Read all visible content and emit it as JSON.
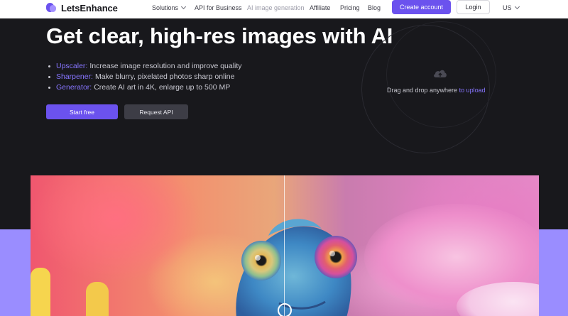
{
  "nav": {
    "brand": "LetsEnhance",
    "links": [
      {
        "label": "Solutions"
      },
      {
        "label": "API for Business"
      },
      {
        "label": "AI image generation"
      },
      {
        "label": "Affiliate"
      },
      {
        "label": "Pricing"
      },
      {
        "label": "Blog"
      }
    ],
    "create_account": "Create account",
    "login": "Login",
    "language": "US"
  },
  "hero": {
    "title": "Get clear, high-res images with AI",
    "features": [
      {
        "key": "Upscaler:",
        "text": "Increase image resolution and improve quality"
      },
      {
        "key": "Sharpener:",
        "text": "Make blurry, pixelated photos sharp online"
      },
      {
        "key": "Generator:",
        "text": "Create AI art in 4K, enlarge up to 500 MP"
      }
    ],
    "start_button": "Start free",
    "api_button": "Request API",
    "upload": {
      "text": "Drag and drop anywhere",
      "link": "to upload"
    }
  },
  "colors": {
    "accent": "#6b52ee",
    "accent_light": "#8775ff",
    "background": "#18181c",
    "band": "#9a8dff"
  }
}
